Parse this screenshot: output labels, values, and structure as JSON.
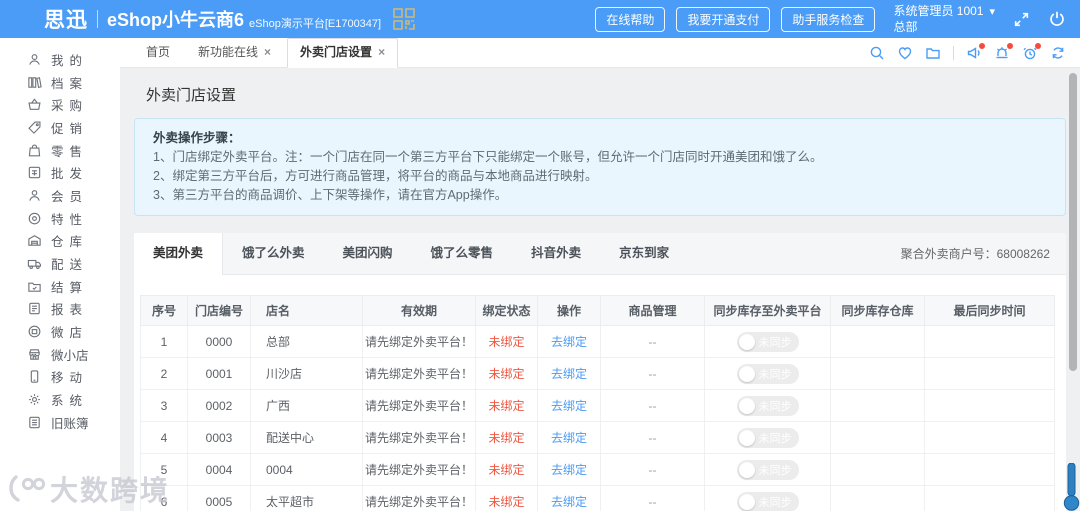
{
  "header": {
    "brand": "思迅",
    "product": "eShop小牛云商6",
    "subtitle": "eShop演示平台[E1700347]",
    "actions": [
      {
        "label": "在线帮助"
      },
      {
        "label": "我要开通支付"
      },
      {
        "label": "助手服务检查"
      }
    ],
    "user": "系统管理员 1001",
    "branch": "总部"
  },
  "nav": {
    "tabs": [
      {
        "label": "首页",
        "closable": false,
        "active": false
      },
      {
        "label": "新功能在线",
        "closable": true,
        "active": false
      },
      {
        "label": "外卖门店设置",
        "closable": true,
        "active": true
      }
    ]
  },
  "sidebar": {
    "items": [
      {
        "icon": "user-icon",
        "label": "我的"
      },
      {
        "icon": "archive-icon",
        "label": "档案"
      },
      {
        "icon": "basket-icon",
        "label": "采购"
      },
      {
        "icon": "tag-icon",
        "label": "促销"
      },
      {
        "icon": "bag-icon",
        "label": "零售"
      },
      {
        "icon": "wholesale-icon",
        "label": "批发"
      },
      {
        "icon": "member-icon",
        "label": "会员"
      },
      {
        "icon": "feature-icon",
        "label": "特性"
      },
      {
        "icon": "warehouse-icon",
        "label": "仓库"
      },
      {
        "icon": "truck-icon",
        "label": "配送"
      },
      {
        "icon": "settle-icon",
        "label": "结算"
      },
      {
        "icon": "report-icon",
        "label": "报表"
      },
      {
        "icon": "microstore-icon",
        "label": "微店"
      },
      {
        "icon": "ministore-icon",
        "label": "微小店"
      },
      {
        "icon": "mobile-icon",
        "label": "移动"
      },
      {
        "icon": "system-icon",
        "label": "系统"
      },
      {
        "icon": "ledger-icon",
        "label": "旧账簿"
      }
    ]
  },
  "page": {
    "title": "外卖门店设置",
    "notice": {
      "title": "外卖操作步骤：",
      "lines": [
        "1、门店绑定外卖平台。注：一个门店在同一个第三方平台下只能绑定一个账号，但允许一个门店同时开通美团和饿了么。",
        "2、绑定第三方平台后，方可进行商品管理，将平台的商品与本地商品进行映射。",
        "3、第三方平台的商品调价、上下架等操作，请在官方App操作。"
      ]
    },
    "platform_tabs": [
      {
        "label": "美团外卖",
        "active": true
      },
      {
        "label": "饿了么外卖",
        "active": false
      },
      {
        "label": "美团闪购",
        "active": false
      },
      {
        "label": "饿了么零售",
        "active": false
      },
      {
        "label": "抖音外卖",
        "active": false
      },
      {
        "label": "京东到家",
        "active": false
      }
    ],
    "merchant_no": "聚合外卖商户号：68008262"
  },
  "table": {
    "headers": [
      "序号",
      "门店编号",
      "店名",
      "有效期",
      "绑定状态",
      "操作",
      "商品管理",
      "同步库存至外卖平台",
      "同步库存仓库",
      "最后同步时间"
    ],
    "rows": [
      {
        "no": "1",
        "store_no": "0000",
        "name": "总部",
        "validity": "请先绑定外卖平台！",
        "status": "未绑定",
        "action": "去绑定",
        "goods": "--",
        "sync_toggle": "未同步",
        "warehouse": "",
        "last_sync": ""
      },
      {
        "no": "2",
        "store_no": "0001",
        "name": "川沙店",
        "validity": "请先绑定外卖平台！",
        "status": "未绑定",
        "action": "去绑定",
        "goods": "--",
        "sync_toggle": "未同步",
        "warehouse": "",
        "last_sync": ""
      },
      {
        "no": "3",
        "store_no": "0002",
        "name": "广西",
        "validity": "请先绑定外卖平台！",
        "status": "未绑定",
        "action": "去绑定",
        "goods": "--",
        "sync_toggle": "未同步",
        "warehouse": "",
        "last_sync": ""
      },
      {
        "no": "4",
        "store_no": "0003",
        "name": "配送中心",
        "validity": "请先绑定外卖平台！",
        "status": "未绑定",
        "action": "去绑定",
        "goods": "--",
        "sync_toggle": "未同步",
        "warehouse": "",
        "last_sync": ""
      },
      {
        "no": "5",
        "store_no": "0004",
        "name": "0004",
        "validity": "请先绑定外卖平台！",
        "status": "未绑定",
        "action": "去绑定",
        "goods": "--",
        "sync_toggle": "未同步",
        "warehouse": "",
        "last_sync": ""
      },
      {
        "no": "6",
        "store_no": "0005",
        "name": "太平超市",
        "validity": "请先绑定外卖平台！",
        "status": "未绑定",
        "action": "去绑定",
        "goods": "--",
        "sync_toggle": "未同步",
        "warehouse": "",
        "last_sync": ""
      }
    ]
  },
  "watermark": "大数跨境",
  "colors": {
    "accent": "#4a9cf6",
    "danger": "#f05742",
    "link": "#4a9af5",
    "qr_gold": "#c9b97c"
  }
}
